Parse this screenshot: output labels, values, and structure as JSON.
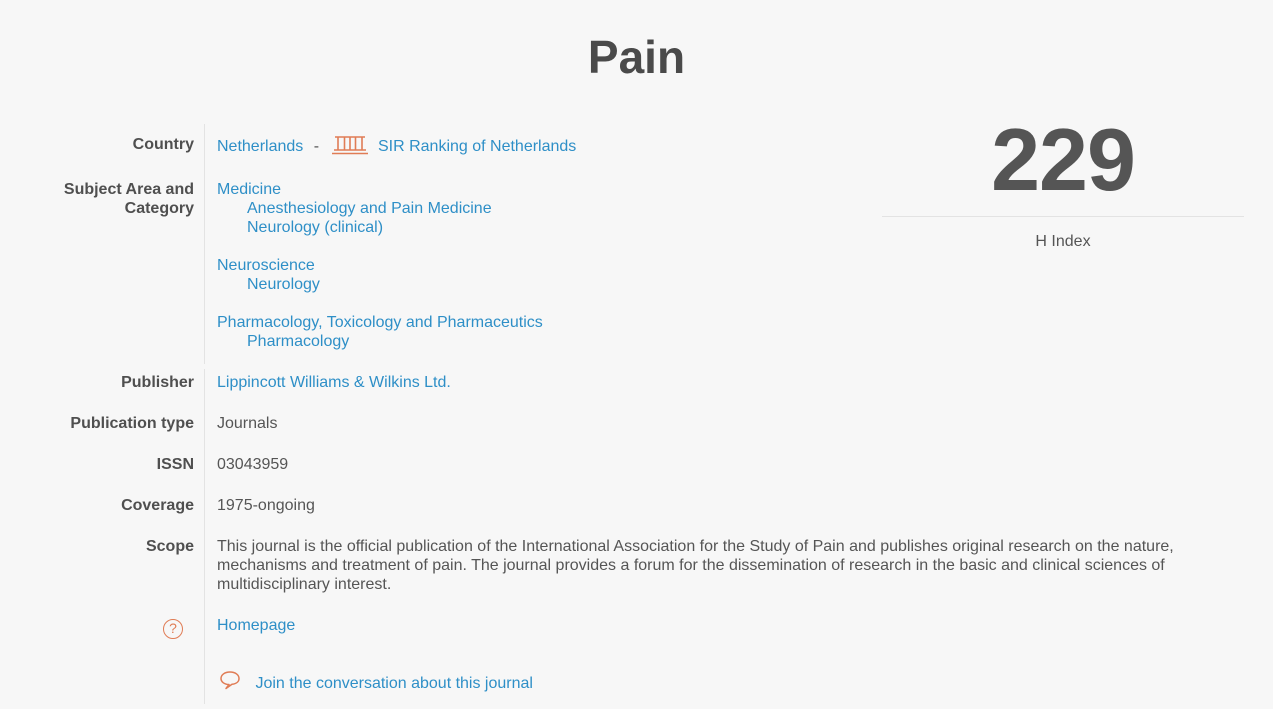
{
  "title": "Pain",
  "h_index": {
    "value": "229",
    "label": "H Index"
  },
  "country": {
    "label": "Country",
    "value": "Netherlands",
    "separator": "-",
    "sir_link": "SIR Ranking of Netherlands"
  },
  "subject": {
    "label_line1": "Subject Area and",
    "label_line2": "Category",
    "groups": [
      {
        "area": "Medicine",
        "categories": [
          "Anesthesiology and Pain Medicine",
          "Neurology (clinical)"
        ]
      },
      {
        "area": "Neuroscience",
        "categories": [
          "Neurology"
        ]
      },
      {
        "area": "Pharmacology, Toxicology and Pharmaceutics",
        "categories": [
          "Pharmacology"
        ]
      }
    ]
  },
  "publisher": {
    "label": "Publisher",
    "value": "Lippincott Williams & Wilkins Ltd."
  },
  "publication_type": {
    "label": "Publication type",
    "value": "Journals"
  },
  "issn": {
    "label": "ISSN",
    "value": "03043959"
  },
  "coverage": {
    "label": "Coverage",
    "value": "1975-ongoing"
  },
  "scope": {
    "label": "Scope",
    "value": "This journal is the official publication of the International Association for the Study of Pain and publishes original research on the nature, mechanisms and treatment of pain. The journal provides a forum for the dissemination of research in the basic and clinical sciences of multidisciplinary interest."
  },
  "homepage": {
    "value": "Homepage",
    "help_glyph": "?"
  },
  "conversation": {
    "value": "Join the conversation about this journal"
  },
  "colors": {
    "link": "#2e8fc7",
    "accent": "#e07c55",
    "text": "#555555",
    "background": "#f7f7f7"
  }
}
